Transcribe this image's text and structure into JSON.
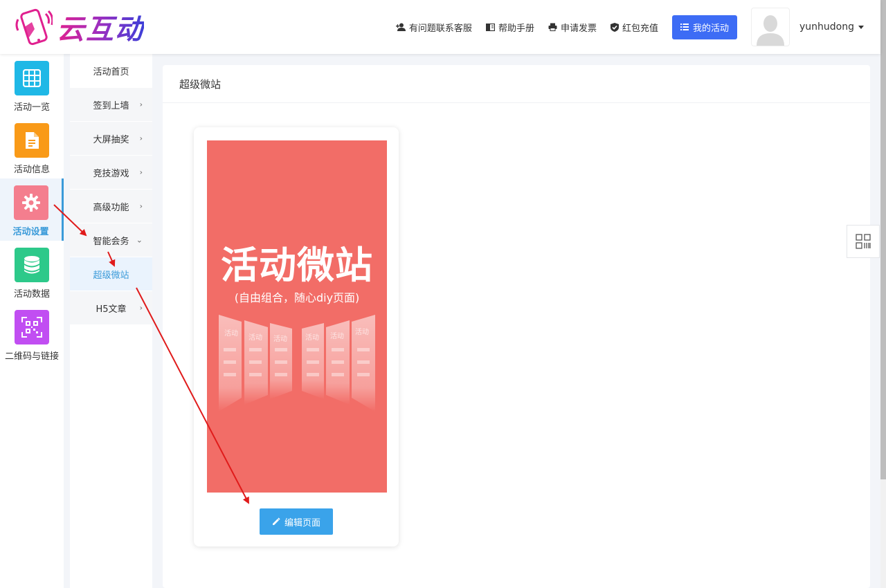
{
  "header": {
    "logo_text": "云互动",
    "nav": [
      {
        "label": "有问题联系客服",
        "icon": "user-add-icon"
      },
      {
        "label": "帮助手册",
        "icon": "book-icon"
      },
      {
        "label": "申请发票",
        "icon": "printer-icon"
      },
      {
        "label": "红包充值",
        "icon": "shield-check-icon"
      }
    ],
    "my_activity": "我的活动",
    "username": "yunhudong"
  },
  "iconbar": [
    {
      "label": "活动一览",
      "color": "#1fb8e6",
      "icon": "grid-icon"
    },
    {
      "label": "活动信息",
      "color": "#f99a18",
      "icon": "document-icon"
    },
    {
      "label": "活动设置",
      "color": "#f47e8e",
      "icon": "gear-icon",
      "active": true
    },
    {
      "label": "活动数据",
      "color": "#2dc98a",
      "icon": "database-icon"
    },
    {
      "label": "二维码与链接",
      "color": "#c14ef2",
      "icon": "qrcode-icon"
    }
  ],
  "submenu": [
    {
      "label": "活动首页",
      "chevron": ""
    },
    {
      "label": "签到上墙",
      "chevron": "›"
    },
    {
      "label": "大屏抽奖",
      "chevron": "›"
    },
    {
      "label": "竞技游戏",
      "chevron": "›"
    },
    {
      "label": "高级功能",
      "chevron": "›"
    },
    {
      "label": "智能会务",
      "chevron": "⌄"
    },
    {
      "label": "超级微站",
      "chevron": "",
      "active": true
    },
    {
      "label": "H5文章",
      "chevron": "›"
    }
  ],
  "main": {
    "title": "超级微站",
    "poster_title": "活动微站",
    "poster_subtitle": "(自由组合，随心diy页面)",
    "poster_card_labels": [
      "活动",
      "活动",
      "活动",
      "活动",
      "活动",
      "活动"
    ],
    "edit_button": "编辑页面"
  }
}
